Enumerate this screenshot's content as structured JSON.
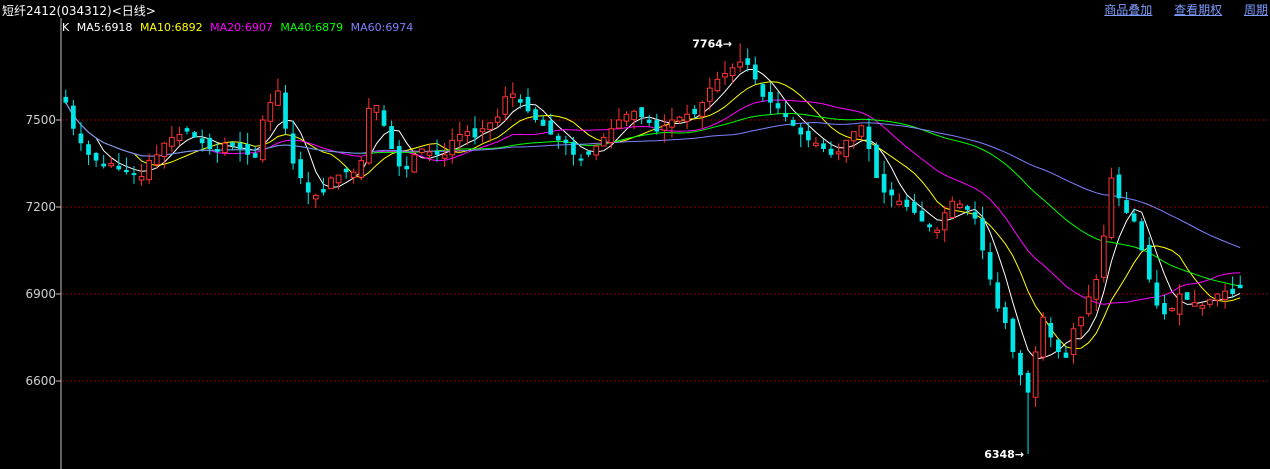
{
  "header": {
    "title": "短纤2412(034312)<日线>",
    "links": [
      "商品叠加",
      "查看期权",
      "周期"
    ]
  },
  "legend": {
    "k_label": "K",
    "items": [
      {
        "text": "MA5:6918",
        "color": "#ffffff"
      },
      {
        "text": "MA10:6892",
        "color": "#ffff00"
      },
      {
        "text": "MA20:6907",
        "color": "#ff00ff"
      },
      {
        "text": "MA40:6879",
        "color": "#00ff00"
      },
      {
        "text": "MA60:6974",
        "color": "#8080ff"
      }
    ]
  },
  "chart_data": {
    "type": "candlestick",
    "y_ticks": [
      6600,
      6900,
      7200,
      7500
    ],
    "ylim": [
      6300,
      7800
    ],
    "grid": true,
    "up_color": "#ff3232",
    "down_color": "#00e6e6",
    "annotations": [
      {
        "label": "7764",
        "value": 7764,
        "at": "high"
      },
      {
        "label": "6348",
        "value": 6348,
        "at": "low"
      }
    ],
    "ma_values": {
      "MA5": 6918,
      "MA10": 6892,
      "MA20": 6907,
      "MA40": 6879,
      "MA60": 6974
    },
    "closes": [
      7560,
      7470,
      7420,
      7380,
      7360,
      7340,
      7350,
      7330,
      7320,
      7310,
      7305,
      7360,
      7380,
      7420,
      7440,
      7450,
      7460,
      7440,
      7420,
      7400,
      7390,
      7420,
      7410,
      7400,
      7380,
      7370,
      7500,
      7560,
      7600,
      7470,
      7350,
      7300,
      7250,
      7240,
      7250,
      7300,
      7310,
      7320,
      7320,
      7360,
      7540,
      7550,
      7480,
      7400,
      7340,
      7330,
      7380,
      7400,
      7390,
      7380,
      7380,
      7430,
      7450,
      7460,
      7440,
      7470,
      7490,
      7510,
      7580,
      7590,
      7560,
      7530,
      7500,
      7480,
      7450,
      7430,
      7420,
      7380,
      7360,
      7380,
      7410,
      7440,
      7470,
      7500,
      7520,
      7530,
      7510,
      7490,
      7460,
      7480,
      7500,
      7510,
      7520,
      7520,
      7560,
      7610,
      7640,
      7660,
      7680,
      7700,
      7690,
      7640,
      7580,
      7560,
      7540,
      7510,
      7480,
      7450,
      7430,
      7420,
      7400,
      7380,
      7390,
      7430,
      7460,
      7480,
      7400,
      7300,
      7250,
      7240,
      7220,
      7200,
      7180,
      7150,
      7130,
      7120,
      7180,
      7220,
      7210,
      7190,
      7160,
      7050,
      6950,
      6850,
      6800,
      6700,
      6620,
      6560,
      6700,
      6820,
      6750,
      6700,
      6680,
      6780,
      6820,
      6890,
      6950,
      7100,
      7300,
      7230,
      7180,
      7150,
      7050,
      6950,
      6860,
      6830,
      6850,
      6900,
      6880,
      6870,
      6860,
      6880,
      6900,
      6910,
      6900,
      6920
    ],
    "volatility_note": ""
  }
}
